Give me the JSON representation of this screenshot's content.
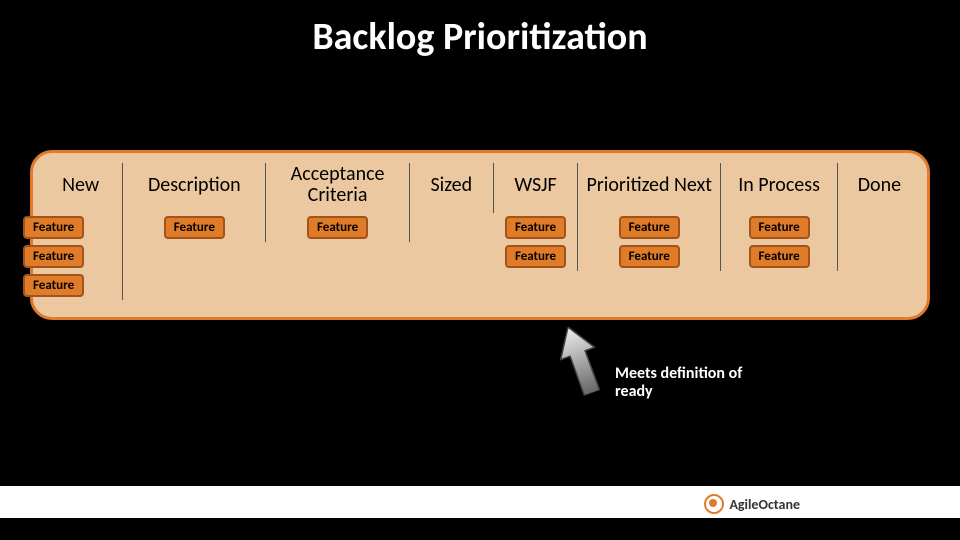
{
  "title": "Backlog Prioritization",
  "card_label": "Feature",
  "columns": [
    {
      "key": "new",
      "header": "New",
      "cards": 3
    },
    {
      "key": "description",
      "header": "Description",
      "cards": 1
    },
    {
      "key": "acceptance",
      "header": "Acceptance Criteria",
      "cards": 1
    },
    {
      "key": "sized",
      "header": "Sized",
      "cards": 0
    },
    {
      "key": "wsjf",
      "header": "WSJF",
      "cards": 2
    },
    {
      "key": "prioritized",
      "header": "Prioritized Next",
      "cards": 2
    },
    {
      "key": "inprocess",
      "header": "In Process",
      "cards": 2
    },
    {
      "key": "done",
      "header": "Done",
      "cards": 0
    }
  ],
  "callout": "Meets definition of ready",
  "brand": {
    "part1": "Agile",
    "part2": "Octane"
  }
}
